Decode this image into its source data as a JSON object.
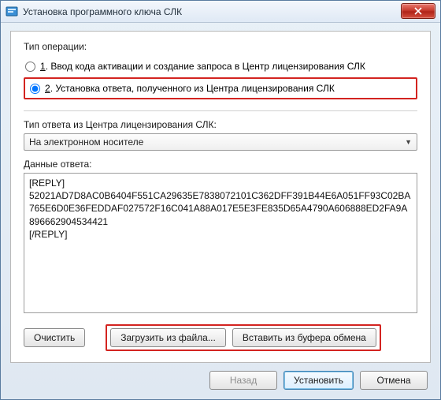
{
  "window": {
    "title": "Установка программного ключа СЛК"
  },
  "operation": {
    "label": "Тип операции:",
    "opt1_num": "1",
    "opt1_text": ". Ввод кода активации и создание запроса в Центр лицензирования СЛК",
    "opt2_num": "2",
    "opt2_text": ". Установка ответа, полученного из Центра лицензирования СЛК"
  },
  "responseType": {
    "label": "Тип ответа из Центра лицензирования СЛК:",
    "selected": "На электронном носителе"
  },
  "responseData": {
    "label": "Данные ответа:",
    "value": "[REPLY]\n52021AD7D8AC0B6404F551CA29635E7838072101C362DFF391B44E6A051FF93C02BA765E6D0E36FEDDAF027572F16C041A88A017E5E3FE835D65A4790A606888ED2FA9A896662904534421\n[/REPLY]"
  },
  "buttons": {
    "clear": "Очистить",
    "loadFile": "Загрузить из файла...",
    "pasteClipboard": "Вставить из буфера обмена",
    "back": "Назад",
    "install": "Установить",
    "cancel": "Отмена"
  }
}
